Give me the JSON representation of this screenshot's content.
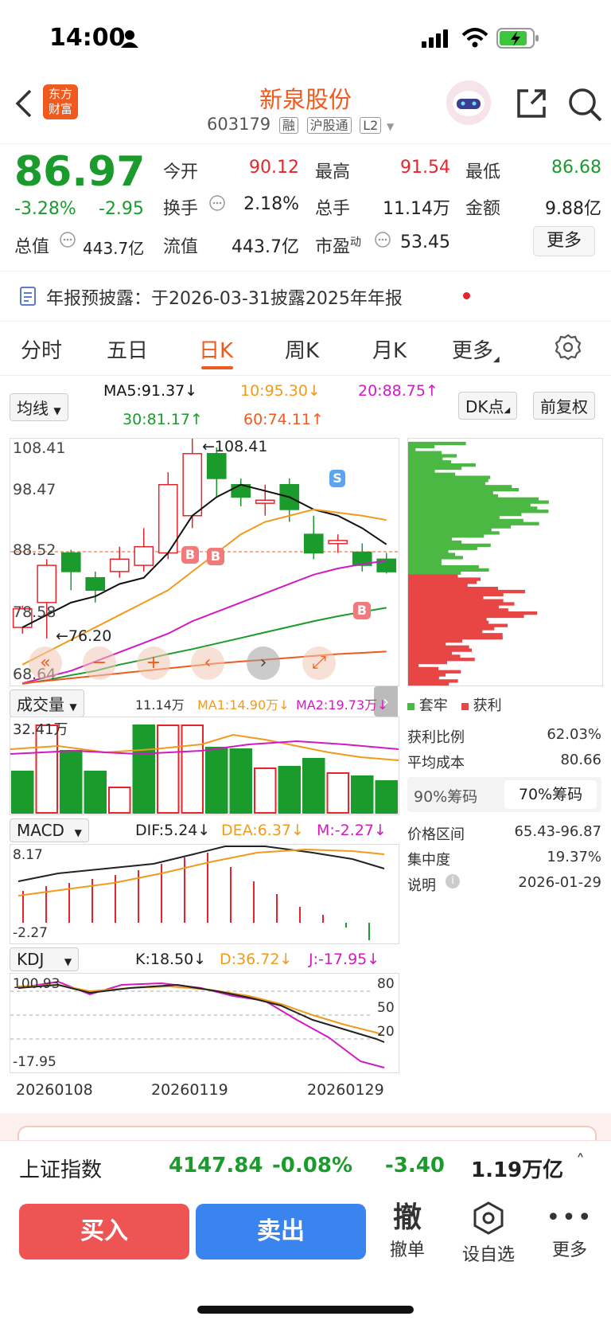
{
  "status_bar": {
    "time": "14:00"
  },
  "header": {
    "logo_line1": "东方",
    "logo_line2": "财富",
    "stock_name": "新泉股份",
    "stock_code": "603179",
    "tags": [
      "融",
      "沪股通",
      "L2"
    ]
  },
  "quote": {
    "price": "86.97",
    "change_pct": "-3.28%",
    "change": "-2.95",
    "total_value_label": "总值",
    "total_value": "443.7亿",
    "fields": [
      {
        "label": "今开",
        "value": "90.12",
        "color": "red"
      },
      {
        "label": "最高",
        "value": "91.54",
        "color": "red"
      },
      {
        "label": "最低",
        "value": "86.68",
        "color": "green"
      },
      {
        "label": "换手",
        "value": "2.18%",
        "color": "black"
      },
      {
        "label": "总手",
        "value": "11.14万",
        "color": "black"
      },
      {
        "label": "金额",
        "value": "9.88亿",
        "color": "black"
      },
      {
        "label": "流值",
        "value": "443.7亿",
        "color": "black"
      },
      {
        "label": "市盈",
        "label_sup": "动",
        "value": "53.45",
        "color": "black"
      }
    ],
    "more": "更多"
  },
  "notice": {
    "text": "年报预披露：于2026-03-31披露2025年年报"
  },
  "tabs": {
    "items": [
      "分时",
      "五日",
      "日K",
      "周K",
      "月K",
      "更多"
    ],
    "active": "日K"
  },
  "ma_bar": {
    "select": "均线",
    "ma5": "MA5:91.37↓",
    "ma10": "10:95.30↓",
    "ma20": "20:88.75↑",
    "ma30": "30:81.17↑",
    "ma60": "60:74.11↑",
    "dk": "DK点",
    "adjust": "前复权"
  },
  "kline": {
    "y_labels": [
      "108.41",
      "98.47",
      "88.52",
      "78.58",
      "68.64"
    ],
    "max_label": "108.41",
    "min_label": "76.20",
    "markers": [
      "B",
      "B",
      "B",
      "B",
      "S"
    ],
    "colors": {
      "up": "#e8242b",
      "down": "#1a9b2c",
      "ma5": "#111111",
      "ma10": "#f29a1b",
      "ma20": "#d21ac2",
      "ma30": "#1a9b2c",
      "ma60": "#f05a1e"
    }
  },
  "volume": {
    "select": "成交量",
    "vol": "11.14万",
    "ma1": "MA1:14.90万↓",
    "ma2": "MA2:19.73万↓",
    "y_label": "32.41万"
  },
  "macd": {
    "select": "MACD",
    "dif": "DIF:5.24↓",
    "dea": "DEA:6.37↓",
    "m": "M:-2.27↓",
    "y_top": "8.17",
    "y_bottom": "-2.27"
  },
  "kdj": {
    "select": "KDJ",
    "k": "K:18.50↓",
    "d": "D:36.72↓",
    "j": "J:-17.95↓",
    "y_top": "100.93",
    "y_bottom": "-17.95",
    "levels": [
      "80",
      "50",
      "20"
    ]
  },
  "dates": [
    "20260108",
    "20260119",
    "20260129"
  ],
  "chips": {
    "legend_trapped": "套牢",
    "legend_profit": "获利",
    "rows": [
      {
        "label": "获利比例",
        "value": "62.03%"
      },
      {
        "label": "平均成本",
        "value": "80.66"
      }
    ],
    "tab_90": "90%筹码",
    "tab_70": "70%筹码",
    "rows2": [
      {
        "label": "价格区间",
        "value": "65.43-96.87"
      },
      {
        "label": "集中度",
        "value": "19.37%"
      },
      {
        "label": "说明",
        "value": "2026-01-29"
      }
    ]
  },
  "index_bar": {
    "name": "上证指数",
    "value": "4147.84",
    "pct": "-0.08%",
    "change": "-3.40",
    "amount": "1.19万亿"
  },
  "bottom": {
    "buy": "买入",
    "sell": "卖出",
    "cancel_icon_text": "撤",
    "cancel": "撤单",
    "watch": "设自选",
    "more": "更多"
  }
}
